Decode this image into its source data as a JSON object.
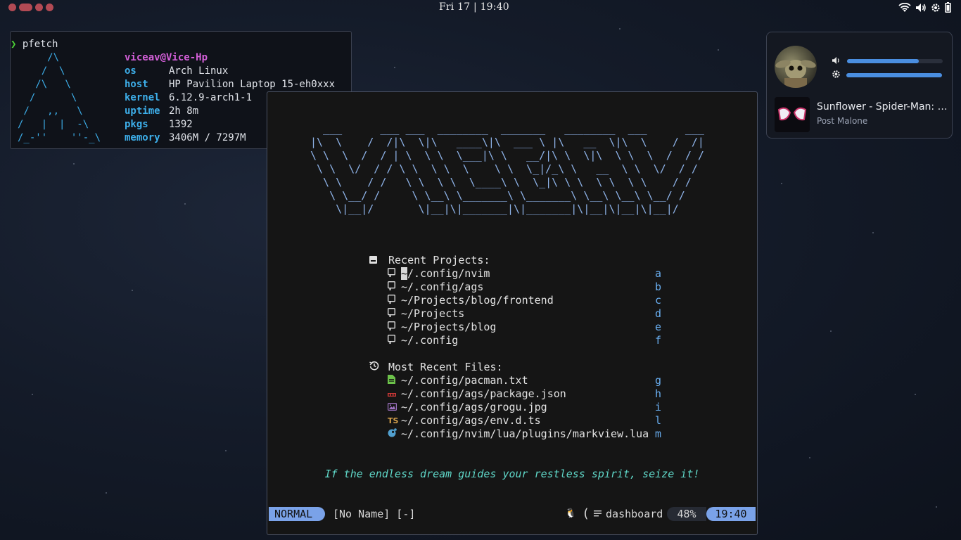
{
  "topbar": {
    "clock": "Fri 17 | 19:40",
    "tray_icons": [
      "wifi-icon",
      "volume-icon",
      "settings-icon",
      "battery-icon"
    ],
    "accent": "#b24a54"
  },
  "pfetch": {
    "command": "pfetch",
    "logo": "     /\\\n    /  \\\n   /\\   \\\n  /      \\\n /   ,,   \\\n/   |  |  -\\\n/_-''    ''-_\\",
    "user": "viceav@Vice-Hp",
    "rows": [
      {
        "key": "os",
        "value": "Arch Linux"
      },
      {
        "key": "host",
        "value": "HP Pavilion Laptop 15-eh0xxx"
      },
      {
        "key": "kernel",
        "value": "6.12.9-arch1-1"
      },
      {
        "key": "uptime",
        "value": "2h 8m"
      },
      {
        "key": "pkgs",
        "value": "1392"
      },
      {
        "key": "memory",
        "value": "3406M / 7297M"
      }
    ]
  },
  "media": {
    "volume_level": 0.75,
    "brightness_level": 1.0,
    "title": "Sunflower - Spider-Man: Into the Spider-Verse",
    "artist": "Post Malone"
  },
  "nvim": {
    "banner": "  ___      ___ ___  ________  _______   ________  ___      ___\n|\\  \\    /  /|\\  \\|\\   ____\\|\\  ___ \\ |\\   __  \\|\\  \\    /  /|\n\\ \\  \\  /  / | \\  \\ \\  \\___|\\ \\   __/|\\ \\  \\|\\  \\ \\  \\  /  / /\n \\ \\  \\/  / / \\ \\  \\ \\  \\    \\ \\  \\_|/_\\ \\   __  \\ \\  \\/  / /\n  \\ \\    / /   \\ \\  \\ \\  \\____\\ \\  \\_|\\ \\ \\  \\ \\  \\ \\    / /\n   \\ \\__/ /     \\ \\__\\ \\_______\\ \\_______\\ \\__\\ \\__\\ \\__/ /\n    \\|__|/       \\|__|\\|_______|\\|_______|\\|__|\\|__|\\|__|/",
    "recent_projects_label": "Recent Projects:",
    "projects": [
      {
        "path": "~/.config/nvim",
        "key": "a"
      },
      {
        "path": "~/.config/ags",
        "key": "b"
      },
      {
        "path": "~/Projects/blog/frontend",
        "key": "c"
      },
      {
        "path": "~/Projects",
        "key": "d"
      },
      {
        "path": "~/Projects/blog",
        "key": "e"
      },
      {
        "path": "~/.config",
        "key": "f"
      }
    ],
    "recent_files_label": "Most Recent Files:",
    "files": [
      {
        "path": "~/.config/pacman.txt",
        "key": "g",
        "icon": "text-file-icon"
      },
      {
        "path": "~/.config/ags/package.json",
        "key": "h",
        "icon": "npm-icon"
      },
      {
        "path": "~/.config/ags/grogu.jpg",
        "key": "i",
        "icon": "image-file-icon"
      },
      {
        "path": "~/.config/ags/env.d.ts",
        "key": "l",
        "icon": "typescript-icon"
      },
      {
        "path": "~/.config/nvim/lua/plugins/markview.lua",
        "key": "m",
        "icon": "lua-icon"
      }
    ],
    "quote": "If the endless dream guides your restless spirit, seize it!",
    "statusline": {
      "mode": "NORMAL",
      "buffer": "[No Name] [-]",
      "filetype": "dashboard",
      "percent": "48%",
      "time": "19:40"
    }
  }
}
